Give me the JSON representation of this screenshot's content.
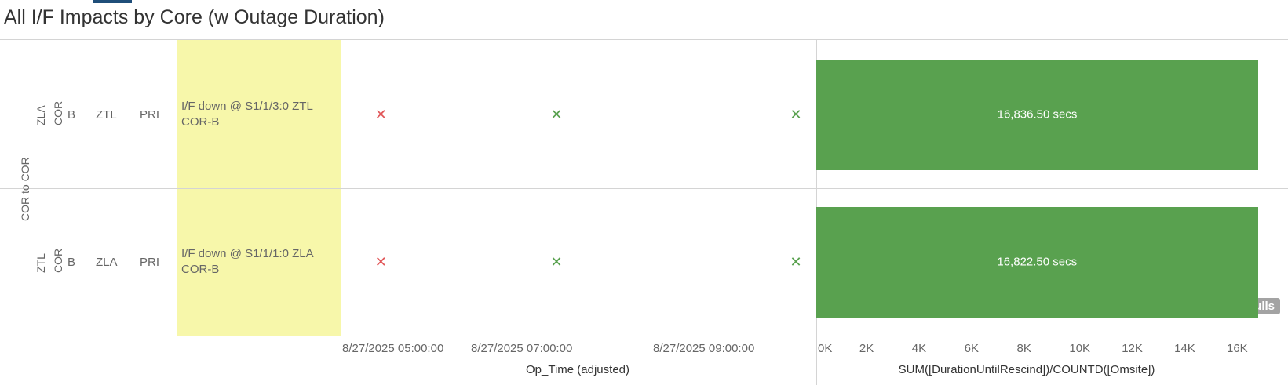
{
  "title": "All I/F Impacts by Core (w Outage Duration)",
  "group_label": "COR to COR",
  "rows": [
    {
      "site": "ZLA",
      "type": "COR",
      "plane": "B",
      "remote": "ZTL",
      "priority": "PRI",
      "description": "I/F down @ S1/1/3:0 ZTL COR-B",
      "marks": [
        {
          "time": "8/27/2025 05:10:00",
          "color": "#e15759"
        },
        {
          "time": "8/27/2025 07:00:00",
          "color": "#59a14f"
        },
        {
          "time": "8/27/2025 09:30:00",
          "color": "#59a14f"
        }
      ],
      "bar_label": "16,836.50 secs"
    },
    {
      "site": "ZTL",
      "type": "COR",
      "plane": "B",
      "remote": "ZLA",
      "priority": "PRI",
      "description": "I/F down @ S1/1/1:0 ZLA COR-B",
      "marks": [
        {
          "time": "8/27/2025 05:10:00",
          "color": "#e15759"
        },
        {
          "time": "8/27/2025 07:00:00",
          "color": "#59a14f"
        },
        {
          "time": "8/27/2025 09:30:00",
          "color": "#59a14f"
        }
      ],
      "bar_label": "16,822.50 secs"
    }
  ],
  "mark_glyph": "✕",
  "chart_data": [
    {
      "type": "scatter",
      "xlabel": "Op_Time (adjusted)",
      "x_ticks": [
        "8/27/2025 05:00:00",
        "8/27/2025 07:00:00",
        "8/27/2025 09:00:00"
      ],
      "series": [
        {
          "points": [
            {
              "row": 0,
              "x": "8/27/2025 05:10:00"
            },
            {
              "row": 1,
              "x": "8/27/2025 05:10:00"
            }
          ]
        },
        {
          "points": [
            {
              "row": 0,
              "x": "8/27/2025 07:00:00"
            },
            {
              "row": 1,
              "x": "8/27/2025 07:00:00"
            },
            {
              "row": 0,
              "x": "8/27/2025 09:30:00"
            },
            {
              "row": 1,
              "x": "8/27/2025 09:30:00"
            }
          ]
        }
      ]
    },
    {
      "type": "bar",
      "orientation": "horizontal",
      "xlabel": "SUM([DurationUntilRescind])/COUNTD([Omsite])",
      "categories": [
        "ZLA COR B ZTL PRI",
        "ZTL COR B ZLA PRI"
      ],
      "values": [
        16836.5,
        16822.5
      ],
      "data_labels": [
        "16,836.50 secs",
        "16,822.50 secs"
      ],
      "xlim": [
        0,
        17000
      ],
      "x_ticks": [
        "0K",
        "2K",
        "4K",
        "6K",
        "8K",
        "10K",
        "12K",
        "14K",
        "16K"
      ],
      "color": "#59a14f",
      "nulls_note": "4 nulls"
    }
  ]
}
